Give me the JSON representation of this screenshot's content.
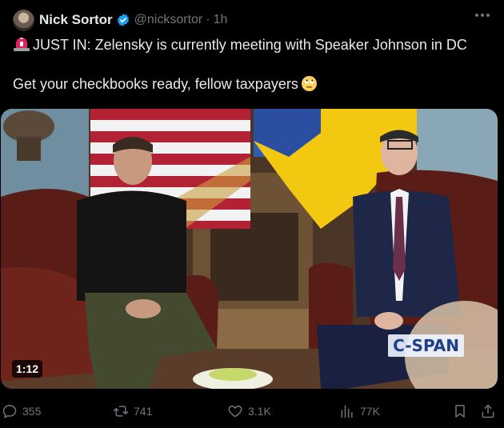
{
  "author": {
    "name": "Nick Sortor",
    "handle": "@nicksortor",
    "separator": "·",
    "time": "1h"
  },
  "tweet": {
    "line1": "JUST IN: Zelensky is currently meeting with Speaker Johnson in DC",
    "line2": "Get your checkbooks ready, fellow taxpayers",
    "line1_emoji": "police-car-light",
    "line2_emoji": "face-with-rolling-eyes"
  },
  "media": {
    "duration": "1:12",
    "watermark": "C-SPAN"
  },
  "actions": {
    "replies": "355",
    "reposts": "741",
    "likes": "3.1K",
    "views": "77K"
  },
  "colors": {
    "background": "#000000",
    "text": "#e7e9ea",
    "muted": "#71767b",
    "verified": "#1d9bf0"
  }
}
